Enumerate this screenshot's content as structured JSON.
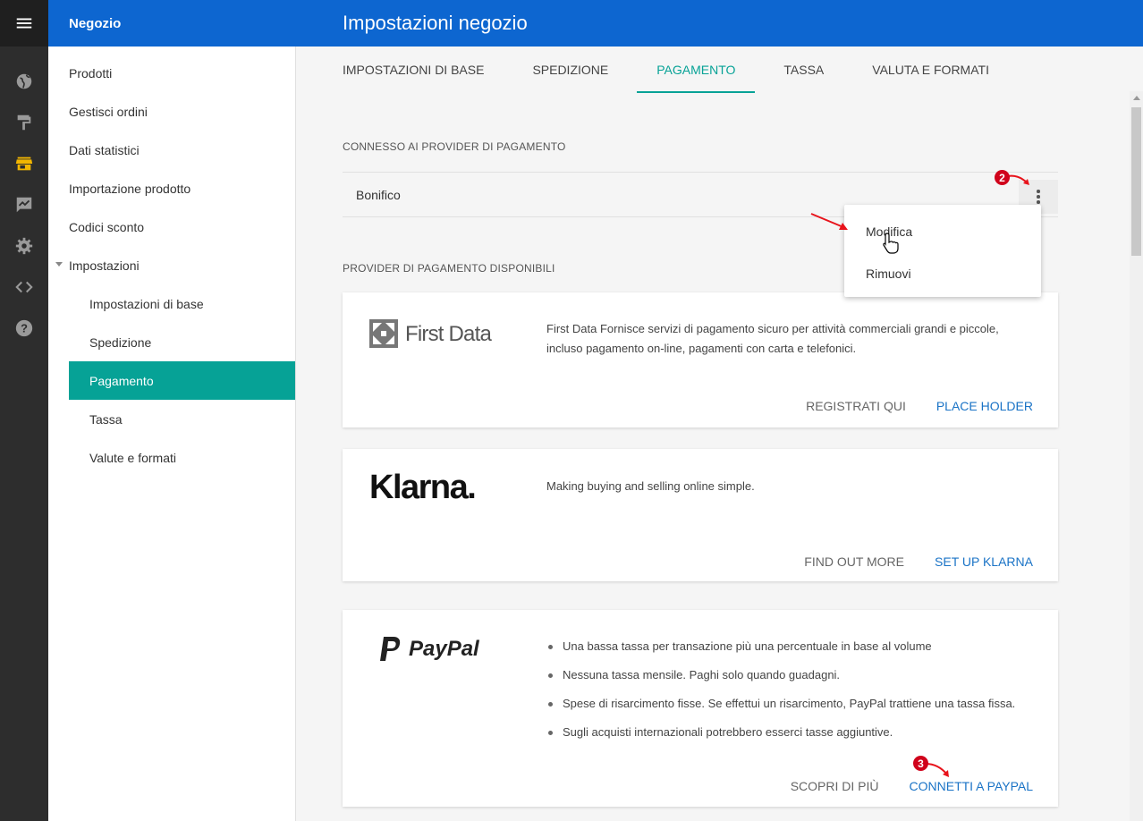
{
  "app": {
    "section_title": "Negozio",
    "page_title": "Impostazioni negozio"
  },
  "rail": {
    "icons": [
      "menu-icon",
      "globe-icon",
      "paint-roller-icon",
      "store-icon",
      "chart-icon",
      "gear-icon",
      "code-icon",
      "help-icon"
    ],
    "active": "store-icon",
    "active_color": "#f2b600"
  },
  "sidebar": {
    "items": [
      {
        "label": "Prodotti"
      },
      {
        "label": "Gestisci ordini"
      },
      {
        "label": "Dati statistici"
      },
      {
        "label": "Importazione prodotto"
      },
      {
        "label": "Codici sconto"
      },
      {
        "label": "Impostazioni"
      },
      {
        "label": "Impostazioni di base"
      },
      {
        "label": "Spedizione"
      },
      {
        "label": "Pagamento"
      },
      {
        "label": "Tassa"
      },
      {
        "label": "Valute e formati"
      }
    ]
  },
  "tabs": [
    {
      "label": "IMPOSTAZIONI DI BASE"
    },
    {
      "label": "SPEDIZIONE"
    },
    {
      "label": "PAGAMENTO"
    },
    {
      "label": "TASSA"
    },
    {
      "label": "VALUTA E FORMATI"
    }
  ],
  "connected": {
    "heading": "CONNESSO AI PROVIDER DI PAGAMENTO",
    "provider": "Bonifico"
  },
  "dropdown": {
    "items": [
      {
        "label": "Modifica"
      },
      {
        "label": "Rimuovi"
      }
    ]
  },
  "available": {
    "heading": "PROVIDER DI PAGAMENTO DISPONIBILI",
    "cards": [
      {
        "logo": "First Data",
        "description": "First Data Fornisce servizi di pagamento sicuro per attività commerciali grandi e piccole, incluso pagamento on-line, pagamenti con carta e telefonici.",
        "secondary": "REGISTRATI QUI",
        "primary": "PLACE HOLDER"
      },
      {
        "logo": "Klarna.",
        "description": "Making buying and selling online simple.",
        "secondary": "FIND OUT MORE",
        "primary": "SET UP KLARNA"
      },
      {
        "logo": "PayPal",
        "bullets": [
          "Una bassa tassa per transazione più una percentuale in base al volume",
          "Nessuna tassa mensile. Paghi solo quando guadagni.",
          "Spese di risarcimento fisse. Se effettui un risarcimento, PayPal trattiene una tassa fissa.",
          "Sugli acquisti internazionali potrebbero esserci tasse aggiuntive."
        ],
        "secondary": "SCOPRI DI PIÙ",
        "primary": "CONNETTI A PAYPAL"
      }
    ]
  },
  "annotations": {
    "step_2": "2",
    "step_3": "3",
    "color": "#e8131b"
  },
  "colors": {
    "header": "#0d66d0",
    "accent": "#06a296",
    "link": "#1a73c6"
  }
}
